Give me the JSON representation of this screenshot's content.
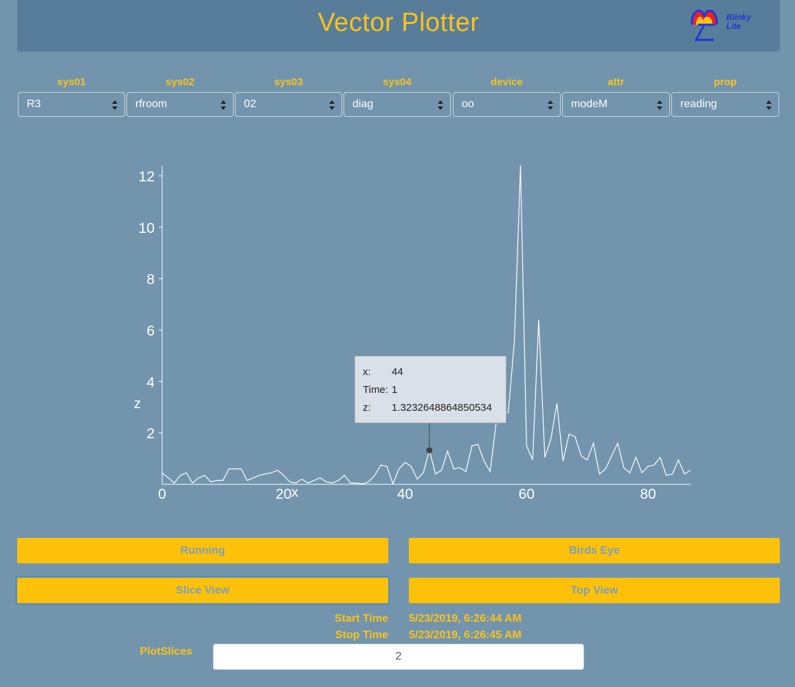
{
  "header": {
    "title": "Vector Plotter",
    "logo_text_1": "Blinky",
    "logo_text_2": "Lite"
  },
  "selectors": [
    {
      "label": "sys01",
      "value": "R3"
    },
    {
      "label": "sys02",
      "value": "rfroom"
    },
    {
      "label": "sys03",
      "value": "02"
    },
    {
      "label": "sys04",
      "value": "diag"
    },
    {
      "label": "device",
      "value": "oo"
    },
    {
      "label": "attr",
      "value": "modeM"
    },
    {
      "label": "prop",
      "value": "reading"
    }
  ],
  "chart_data": {
    "type": "line",
    "xlabel": "x",
    "ylabel": "z",
    "xticks": [
      0,
      20,
      40,
      60,
      80
    ],
    "yticks": [
      2,
      4,
      6,
      8,
      10,
      12
    ],
    "xlim": [
      0,
      87
    ],
    "ylim": [
      0,
      12.4
    ],
    "grid": false,
    "x": [
      0,
      1,
      2,
      3,
      4,
      5,
      6,
      7,
      8,
      9,
      10,
      11,
      12,
      13,
      14,
      15,
      16,
      17,
      18,
      19,
      20,
      21,
      22,
      23,
      24,
      25,
      26,
      27,
      28,
      29,
      30,
      31,
      32,
      33,
      34,
      35,
      36,
      37,
      38,
      39,
      40,
      41,
      42,
      43,
      44,
      45,
      46,
      47,
      48,
      49,
      50,
      51,
      52,
      53,
      54,
      55,
      56,
      57,
      58,
      59,
      60,
      61,
      62,
      63,
      64,
      65,
      66,
      67,
      68,
      69,
      70,
      71,
      72,
      73,
      74,
      75,
      76,
      77,
      78,
      79,
      80,
      81,
      82,
      83,
      84,
      85,
      86,
      87
    ],
    "values": [
      0.45,
      0.25,
      0.05,
      0.35,
      0.45,
      0.05,
      0.25,
      0.35,
      0.1,
      0.15,
      0.15,
      0.6,
      0.6,
      0.6,
      0.15,
      0.25,
      0.35,
      0.4,
      0.45,
      0.55,
      0.35,
      0.1,
      0.05,
      0.2,
      0.05,
      0.15,
      0.25,
      0.1,
      0.05,
      0.15,
      0.35,
      0.05,
      0.05,
      0.02,
      0.1,
      0.35,
      0.75,
      0.7,
      0.02,
      0.6,
      0.85,
      0.7,
      0.2,
      0.45,
      1.32,
      0.4,
      0.55,
      1.3,
      0.6,
      0.65,
      0.5,
      1.5,
      1.55,
      0.9,
      0.5,
      2.4,
      2.75,
      2.8,
      5.6,
      12.4,
      1.5,
      0.95,
      6.4,
      1.05,
      1.75,
      3.15,
      0.9,
      1.95,
      1.85,
      1.1,
      0.95,
      1.6,
      0.4,
      0.6,
      1.1,
      1.6,
      0.65,
      0.45,
      1.05,
      0.45,
      0.7,
      0.75,
      1.05,
      0.35,
      0.4,
      0.95,
      0.4,
      0.55
    ],
    "tooltip": {
      "x_label": "x:",
      "x_value": "44",
      "time_label": "Time:",
      "time_value": "1",
      "z_label": "z:",
      "z_value": "1.3232648864850534"
    }
  },
  "buttons": {
    "running": "Running",
    "birds_eye": "Birds Eye",
    "slice_view": "Slice View",
    "top_view": "Top View"
  },
  "info": {
    "start_label": "Start Time",
    "start_value": "5/23/2019, 6:26:44 AM",
    "stop_label": "Stop Time",
    "stop_value": "5/23/2019, 6:26:45 AM",
    "plotslices_label": "PlotSlices",
    "plotslices_value": "2"
  },
  "colors": {
    "background": "#7295ad",
    "header": "#587d9a",
    "accent": "#fbc21a",
    "button": "#fdc10a"
  }
}
